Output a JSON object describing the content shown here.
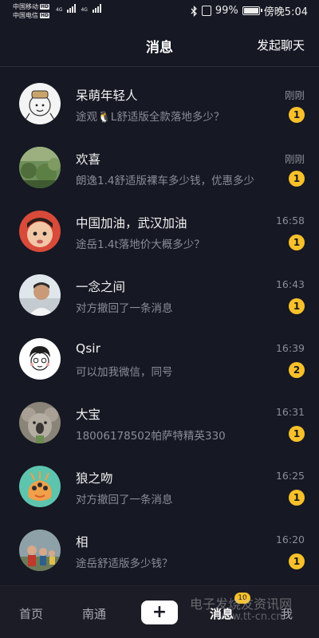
{
  "status_bar": {
    "carrier1": "中国移动",
    "carrier2": "中国电信",
    "hd": "HD",
    "net1": "4G",
    "net2": "4G",
    "battery_percent": "99%",
    "battery_level": 0.99,
    "time": "傍晚5:04"
  },
  "header": {
    "title": "消息",
    "start_chat": "发起聊天"
  },
  "messages": [
    {
      "name": "呆萌年轻人",
      "preview": "途观🐧L舒适版全款落地多少？",
      "time": "刚刚",
      "unread": "1"
    },
    {
      "name": "欢喜",
      "preview": "朗逸1.4舒适版裸车多少钱，优惠多少",
      "time": "刚刚",
      "unread": "1"
    },
    {
      "name": "中国加油，武汉加油",
      "preview": "途岳1.4t落地价大概多少？",
      "time": "16:58",
      "unread": "1"
    },
    {
      "name": "一念之间",
      "preview": "对方撤回了一条消息",
      "time": "16:43",
      "unread": "1"
    },
    {
      "name": "Qsir",
      "preview": "可以加我微信，同号",
      "time": "16:39",
      "unread": "2"
    },
    {
      "name": "大宝",
      "preview": "18006178502帕萨特精英330",
      "time": "16:31",
      "unread": "1"
    },
    {
      "name": "狼之吻",
      "preview": "对方撤回了一条消息",
      "time": "16:25",
      "unread": "1"
    },
    {
      "name": "相",
      "preview": "途岳舒适版多少钱？",
      "time": "16:20",
      "unread": "1"
    }
  ],
  "bottom_nav": {
    "home": "首页",
    "city": "南通",
    "plus": "+",
    "messages": "消息",
    "messages_badge": "10",
    "me": "我"
  },
  "watermark": {
    "line1": "电子发烧友资讯网",
    "line2": "www.tt-cn.cn"
  },
  "colors": {
    "background": "#161823",
    "badge": "#f8c12a",
    "cyan_accent": "#33e5e5",
    "pink_accent": "#f03a6c"
  }
}
